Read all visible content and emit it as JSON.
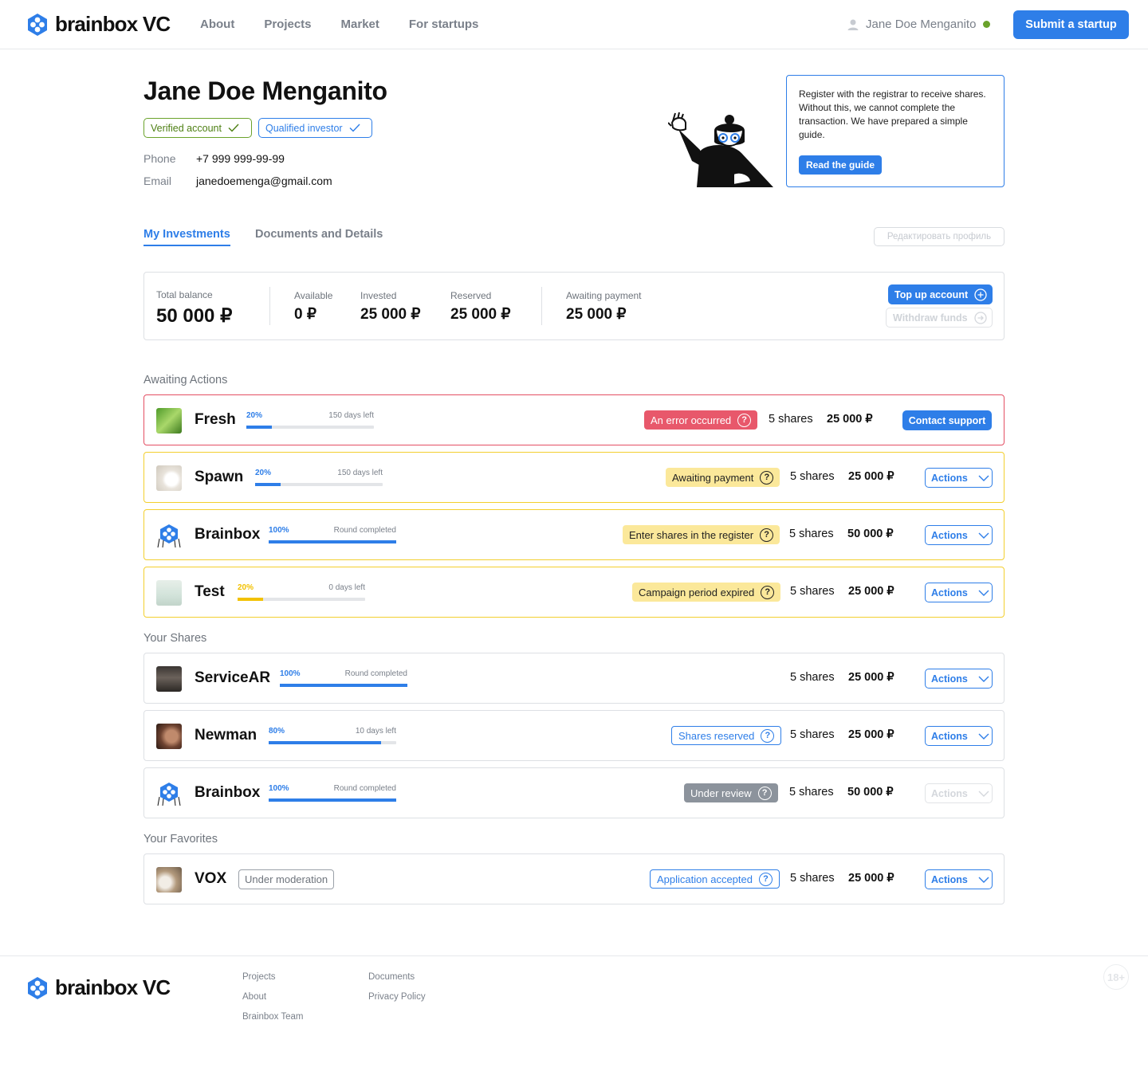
{
  "brand": {
    "name": "brainbox VC",
    "primary_color": "#2e7ee8"
  },
  "nav": {
    "items": [
      "About",
      "Projects",
      "Market",
      "For startups"
    ]
  },
  "user": {
    "name": "Jane Doe Menganito",
    "status": "online"
  },
  "header": {
    "submit_label": "Submit a startup"
  },
  "profile": {
    "name": "Jane Doe Menganito",
    "badges": [
      "Verified account",
      "Qualified investor"
    ],
    "phone_label": "Phone",
    "phone": "+7 999 999-99-99",
    "email_label": "Email",
    "email": "janedoemenga@gmail.com"
  },
  "guide": {
    "text": "Register with the registrar to receive shares. Without this, we cannot complete the transaction. We have prepared a simple guide.",
    "button": "Read the guide"
  },
  "tabs": [
    "My Investments",
    "Documents and Details"
  ],
  "edit_profile": "Редактировать профиль",
  "balance": {
    "total_label": "Total balance",
    "total": "50 000 ₽",
    "available_label": "Available",
    "available": "0 ₽",
    "invested_label": "Invested",
    "invested": "25 000 ₽",
    "reserved_label": "Reserved",
    "reserved": "25 000 ₽",
    "awaiting_label": "Awaiting payment",
    "awaiting": "25 000 ₽",
    "topup": "Top up account",
    "withdraw": "Withdraw funds"
  },
  "sections": {
    "awaiting": "Awaiting Actions",
    "shares": "Your Shares",
    "favorites": "Your Favorites"
  },
  "awaiting": [
    {
      "name": "Fresh",
      "pct": "20%",
      "progress": 0.2,
      "note": "150 days left",
      "status": "An error occurred",
      "shares": "5 shares",
      "amount": "25 000 ₽",
      "action": "Contact support"
    },
    {
      "name": "Spawn",
      "pct": "20%",
      "progress": 0.2,
      "note": "150 days left",
      "status": "Awaiting payment",
      "shares": "5 shares",
      "amount": "25 000 ₽",
      "action": "Actions"
    },
    {
      "name": "Brainbox",
      "pct": "100%",
      "progress": 1.0,
      "note": "Round completed",
      "status": "Enter shares in the register",
      "shares": "5 shares",
      "amount": "50 000 ₽",
      "action": "Actions"
    },
    {
      "name": "Test",
      "pct": "20%",
      "progress": 0.2,
      "note": "0 days left",
      "status": "Campaign period expired",
      "shares": "5 shares",
      "amount": "25 000 ₽",
      "action": "Actions"
    }
  ],
  "shares_list": [
    {
      "name": "ServiceAR",
      "pct": "100%",
      "progress": 1.0,
      "note": "Round completed",
      "shares": "5 shares",
      "amount": "25 000 ₽",
      "action": "Actions"
    },
    {
      "name": "Newman",
      "pct": "80%",
      "progress": 0.88,
      "note": "10 days left",
      "status": "Shares reserved",
      "shares": "5 shares",
      "amount": "25 000 ₽",
      "action": "Actions"
    },
    {
      "name": "Brainbox",
      "pct": "100%",
      "progress": 1.0,
      "note": "Round completed",
      "status": "Under review",
      "shares": "5 shares",
      "amount": "50 000 ₽",
      "action": "Actions"
    }
  ],
  "favorites": [
    {
      "name": "VOX",
      "tag": "Under moderation",
      "status": "Application accepted",
      "shares": "5 shares",
      "amount": "25 000 ₽",
      "action": "Actions"
    }
  ],
  "footer": {
    "col1": [
      "Projects",
      "About",
      "Brainbox Team"
    ],
    "col2": [
      "Documents",
      "Privacy Policy"
    ],
    "age": "18+"
  }
}
